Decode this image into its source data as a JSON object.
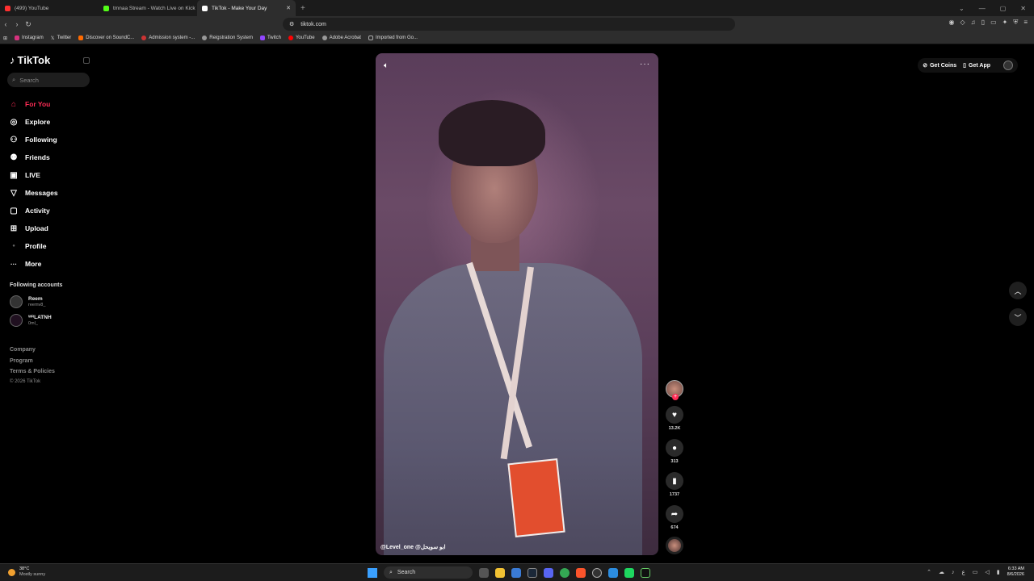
{
  "browser": {
    "tabs": [
      {
        "title": "(499) YouTube",
        "color": "#ff3030"
      },
      {
        "title": "tmnaa Stream - Watch Live on Kick",
        "color": "#53fc18"
      },
      {
        "title": "TikTok - Make Your Day",
        "color": "#ffffff"
      }
    ],
    "new_tab": "+",
    "url": "tiktok.com",
    "bookmarks": [
      {
        "label": "Instagram",
        "color": "#d6327e"
      },
      {
        "label": "Twitter",
        "color": "#dddddd"
      },
      {
        "label": "Discover on SoundC...",
        "color": "#ff6a00"
      },
      {
        "label": "Admission system -...",
        "color": "#cc3333"
      },
      {
        "label": "Reigstration System",
        "color": "#999999"
      },
      {
        "label": "Twitch",
        "color": "#9146ff"
      },
      {
        "label": "YouTube",
        "color": "#ff0000"
      },
      {
        "label": "Adobe Acrobat",
        "color": "#999999"
      },
      {
        "label": "Imported from Go...",
        "color": "#777777"
      }
    ]
  },
  "tiktok": {
    "logo": "TikTok",
    "search_placeholder": "Search",
    "nav": [
      {
        "label": "For You",
        "icon": "home-icon",
        "glyph": "⌂",
        "active": true
      },
      {
        "label": "Explore",
        "icon": "compass-icon",
        "glyph": "◎"
      },
      {
        "label": "Following",
        "icon": "user-plus-icon",
        "glyph": "⚇"
      },
      {
        "label": "Friends",
        "icon": "friends-icon",
        "glyph": "⚉"
      },
      {
        "label": "LIVE",
        "icon": "live-icon",
        "glyph": "▣"
      },
      {
        "label": "Messages",
        "icon": "paper-plane-icon",
        "glyph": "▽"
      },
      {
        "label": "Activity",
        "icon": "activity-icon",
        "glyph": "▢"
      },
      {
        "label": "Upload",
        "icon": "upload-icon",
        "glyph": "⊞"
      },
      {
        "label": "Profile",
        "icon": "profile-icon",
        "glyph": "●"
      },
      {
        "label": "More",
        "icon": "more-icon",
        "glyph": "···"
      }
    ],
    "following_title": "Following accounts",
    "accounts": [
      {
        "name": "Reem",
        "handle": "reemv8_"
      },
      {
        "name": "ᵂᴿLATNH",
        "handle": "0ml_"
      }
    ],
    "footer": [
      "Company",
      "Program",
      "Terms & Policies"
    ],
    "copyright": "© 2026 TikTok",
    "get_coins": "Get Coins",
    "get_app": "Get App",
    "video": {
      "caption": "@Level_one @ابو سويحل",
      "likes": "13.2K",
      "comments": "313",
      "saves": "1737",
      "shares": "674"
    }
  },
  "taskbar": {
    "temp": "38°C",
    "weather": "Mostly sunny",
    "search": "Search",
    "time": "6:33 AM",
    "date": "8/6/2026"
  }
}
